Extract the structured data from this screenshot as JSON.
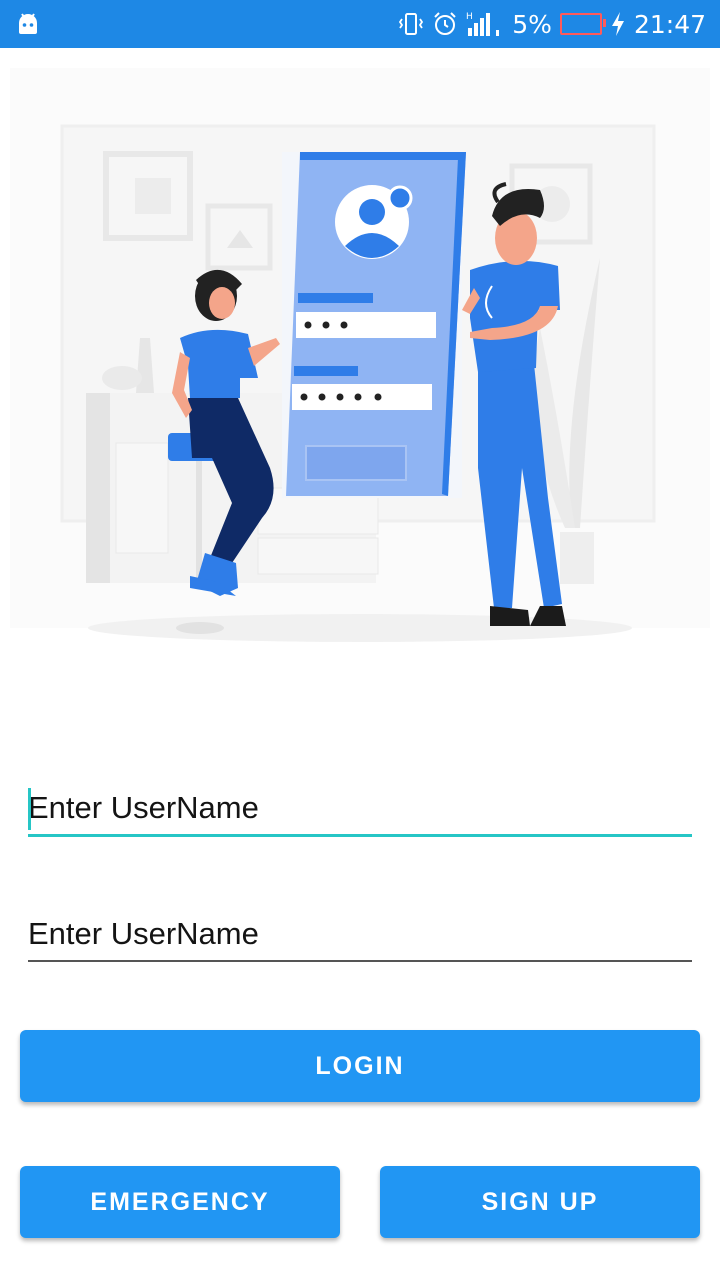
{
  "status_bar": {
    "battery_percent": "5%",
    "time": "21:47",
    "network_label": "H",
    "icons": [
      "android-icon",
      "vibrate-icon",
      "alarm-icon",
      "signal-icon",
      "battery-icon",
      "charging-icon"
    ]
  },
  "illustration": {
    "description_icon": "login-illustration"
  },
  "form": {
    "username_placeholder": "Enter UserName",
    "password_placeholder": "Enter UserName"
  },
  "buttons": {
    "login": "LOGIN",
    "emergency": "EMERGENCY",
    "signup": "SIGN UP"
  },
  "colors": {
    "status_bar": "#1e88e5",
    "button": "#2196f3",
    "accent": "#26c6c6"
  }
}
